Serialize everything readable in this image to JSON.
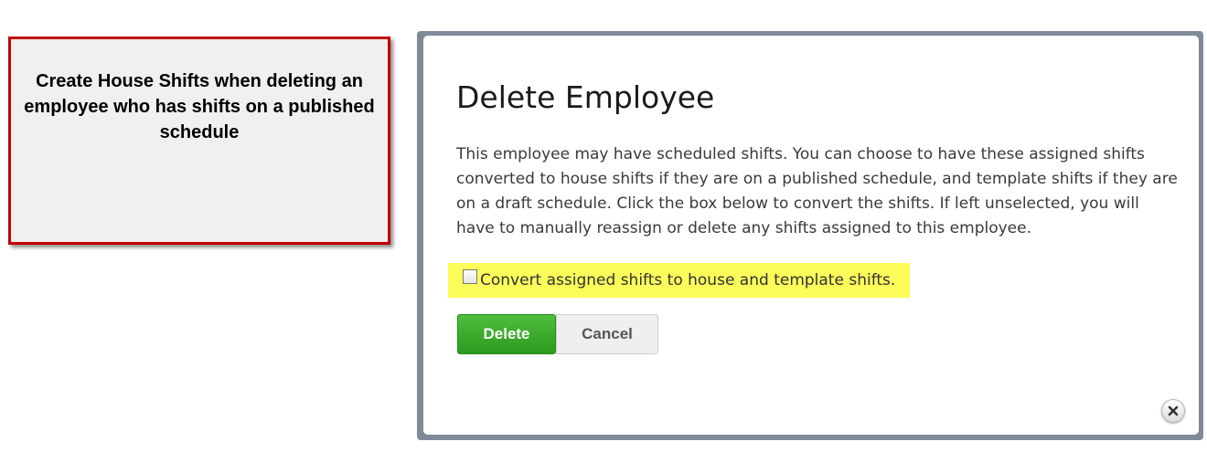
{
  "callout": {
    "text": "Create House Shifts when deleting an employee who has shifts on a published schedule",
    "border_color": "#c00000"
  },
  "dialog": {
    "title": "Delete Employee",
    "body": "This employee may have scheduled shifts. You can choose to have these assigned shifts converted to house shifts if they are on a published schedule, and template shifts if they are on a draft schedule. Click the box below to convert the shifts. If left unselected, you will have to manually reassign or delete any shifts assigned to this employee.",
    "checkbox": {
      "label": "Convert assigned shifts to house and template shifts.",
      "checked": false,
      "highlight_color": "#fcfc5a"
    },
    "buttons": {
      "delete_label": "Delete",
      "cancel_label": "Cancel"
    },
    "close_icon": "close-icon",
    "accent_color": "#2b9a1f"
  }
}
